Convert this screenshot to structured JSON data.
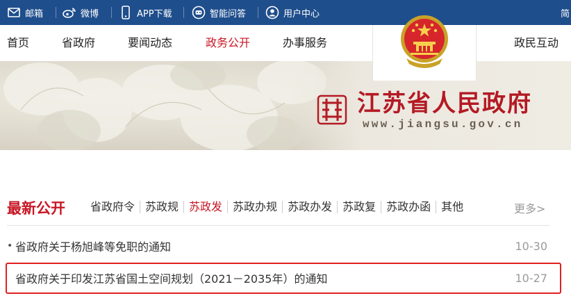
{
  "topbar": {
    "items": [
      {
        "label": "邮箱",
        "icon": "mail-icon"
      },
      {
        "label": "微博",
        "icon": "weibo-icon"
      },
      {
        "label": "APP下载",
        "icon": "phone-icon"
      },
      {
        "label": "智能问答",
        "icon": "chat-robot-icon"
      },
      {
        "label": "用户中心",
        "icon": "user-icon"
      }
    ],
    "lang_label": "简",
    "background_color": "#1f4e8c"
  },
  "nav": {
    "items": [
      {
        "label": "首页"
      },
      {
        "label": "省政府"
      },
      {
        "label": "要闻动态"
      },
      {
        "label": "政务公开"
      },
      {
        "label": "办事服务"
      },
      {
        "label": "政民互动"
      }
    ],
    "active_index": 3,
    "active_color": "#c81623"
  },
  "banner": {
    "site_title": "江苏省人民政府",
    "site_url": "www.jiangsu.gov.cn",
    "emblem_icon": "national-emblem-icon",
    "logo_icon": "jiangsu-seal-icon",
    "title_color": "#b41a24"
  },
  "news": {
    "section_title": "最新公开",
    "tabs": [
      {
        "label": "省政府令"
      },
      {
        "label": "苏政规"
      },
      {
        "label": "苏政发"
      },
      {
        "label": "苏政办规"
      },
      {
        "label": "苏政办发"
      },
      {
        "label": "苏政复"
      },
      {
        "label": "苏政办函"
      },
      {
        "label": "其他"
      }
    ],
    "active_tab_index": 2,
    "more_label": "更多>",
    "rows": [
      {
        "title": "省政府关于杨旭峰等免职的通知",
        "date": "10-30"
      },
      {
        "title": "省政府关于印发江苏省国土空间规划（2021－2035年）的通知",
        "date": "10-27"
      }
    ],
    "highlight_color": "#e02020"
  }
}
